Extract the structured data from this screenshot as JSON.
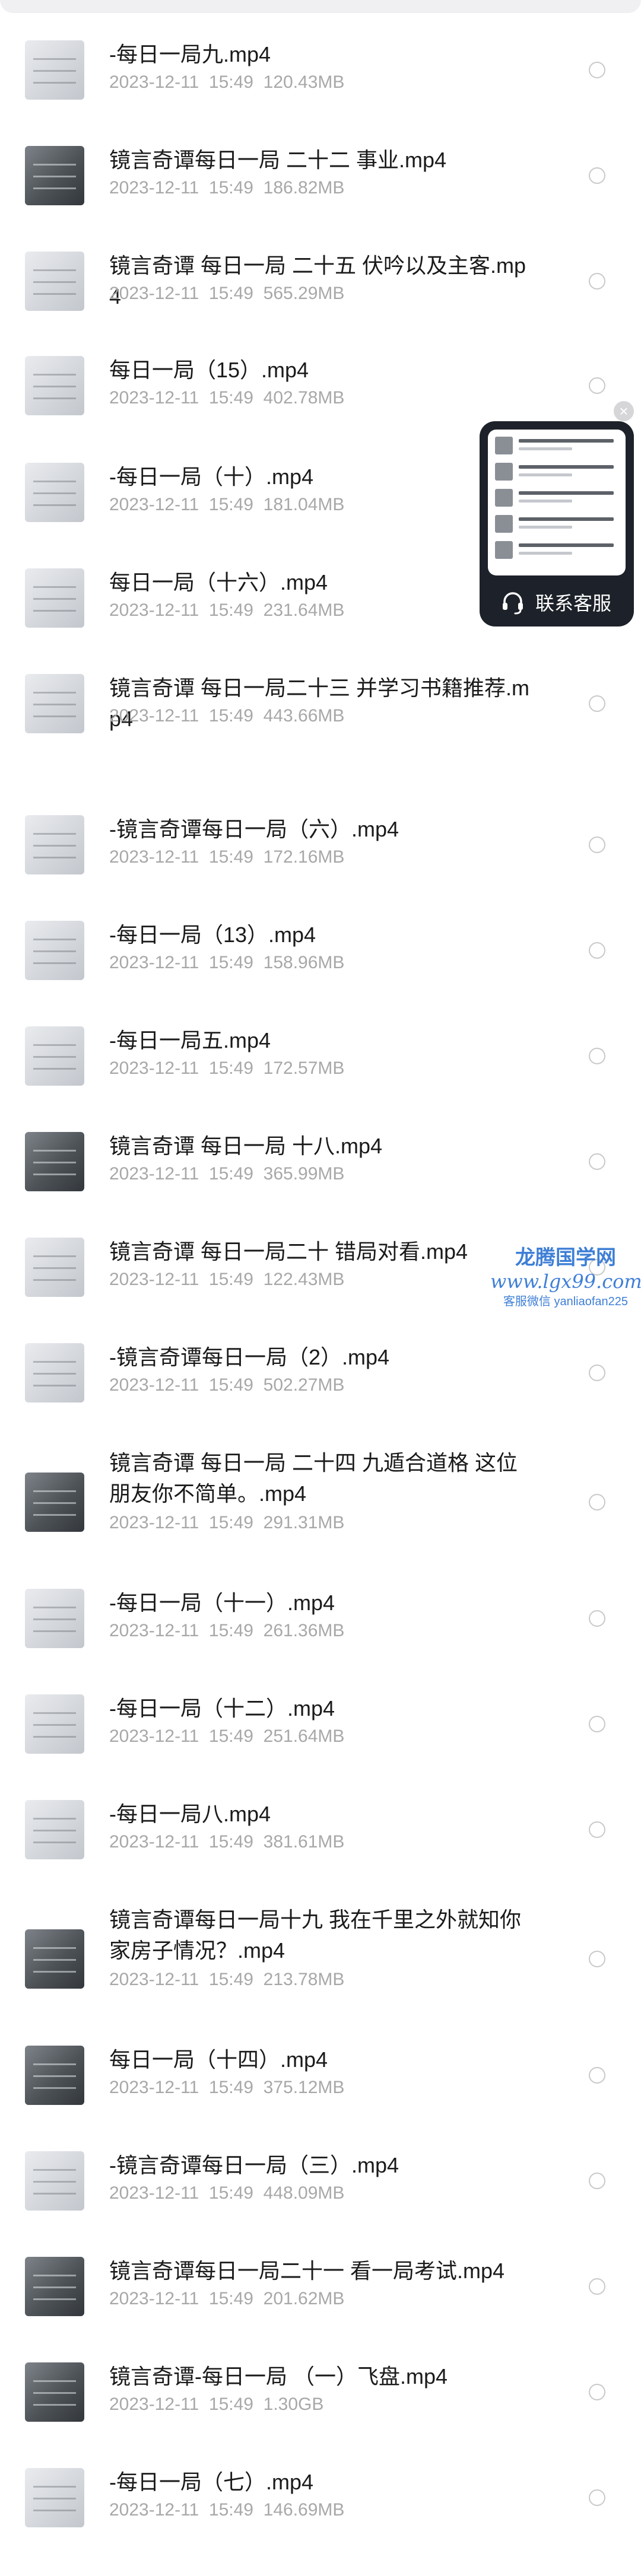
{
  "files": [
    {
      "name": "-每日一局九.mp4",
      "date": "2023-12-11",
      "time": "15:49",
      "size": "120.43MB",
      "thumb": "light"
    },
    {
      "name": "镜言奇谭每日一局 二十二 事业.mp4",
      "date": "2023-12-11",
      "time": "15:49",
      "size": "186.82MB",
      "thumb": "dark"
    },
    {
      "name": "镜言奇谭 每日一局 二十五 伏吟以及主客.mp4",
      "date": "2023-12-11",
      "time": "15:49",
      "size": "565.29MB",
      "thumb": "light"
    },
    {
      "name": "每日一局（15）.mp4",
      "date": "2023-12-11",
      "time": "15:49",
      "size": "402.78MB",
      "thumb": "light"
    },
    {
      "name": "-每日一局（十）.mp4",
      "date": "2023-12-11",
      "time": "15:49",
      "size": "181.04MB",
      "thumb": "light"
    },
    {
      "name": "每日一局（十六）.mp4",
      "date": "2023-12-11",
      "time": "15:49",
      "size": "231.64MB",
      "thumb": "light"
    },
    {
      "name": "镜言奇谭 每日一局二十三 并学习书籍推荐.mp4",
      "date": "2023-12-11",
      "time": "15:49",
      "size": "443.66MB",
      "thumb": "light"
    },
    {
      "name": "-镜言奇谭每日一局（六）.mp4",
      "date": "2023-12-11",
      "time": "15:49",
      "size": "172.16MB",
      "thumb": "light"
    },
    {
      "name": "-每日一局（13）.mp4",
      "date": "2023-12-11",
      "time": "15:49",
      "size": "158.96MB",
      "thumb": "light"
    },
    {
      "name": "-每日一局五.mp4",
      "date": "2023-12-11",
      "time": "15:49",
      "size": "172.57MB",
      "thumb": "light"
    },
    {
      "name": "镜言奇谭 每日一局 十八.mp4",
      "date": "2023-12-11",
      "time": "15:49",
      "size": "365.99MB",
      "thumb": "dark"
    },
    {
      "name": "镜言奇谭 每日一局二十 错局对看.mp4",
      "date": "2023-12-11",
      "time": "15:49",
      "size": "122.43MB",
      "thumb": "light"
    },
    {
      "name": "-镜言奇谭每日一局（2）.mp4",
      "date": "2023-12-11",
      "time": "15:49",
      "size": "502.27MB",
      "thumb": "light"
    },
    {
      "name": "镜言奇谭 每日一局 二十四 九遁合道格 这位朋友你不简单。.mp4",
      "date": "2023-12-11",
      "time": "15:49",
      "size": "291.31MB",
      "thumb": "dark"
    },
    {
      "name": "-每日一局（十一）.mp4",
      "date": "2023-12-11",
      "time": "15:49",
      "size": "261.36MB",
      "thumb": "light"
    },
    {
      "name": "-每日一局（十二）.mp4",
      "date": "2023-12-11",
      "time": "15:49",
      "size": "251.64MB",
      "thumb": "light"
    },
    {
      "name": "-每日一局八.mp4",
      "date": "2023-12-11",
      "time": "15:49",
      "size": "381.61MB",
      "thumb": "light"
    },
    {
      "name": "镜言奇谭每日一局十九  我在千里之外就知你家房子情况？.mp4",
      "date": "2023-12-11",
      "time": "15:49",
      "size": "213.78MB",
      "thumb": "dark"
    },
    {
      "name": "每日一局（十四）.mp4",
      "date": "2023-12-11",
      "time": "15:49",
      "size": "375.12MB",
      "thumb": "dark"
    },
    {
      "name": "-镜言奇谭每日一局（三）.mp4",
      "date": "2023-12-11",
      "time": "15:49",
      "size": "448.09MB",
      "thumb": "light"
    },
    {
      "name": "镜言奇谭每日一局二十一  看一局考试.mp4",
      "date": "2023-12-11",
      "time": "15:49",
      "size": "201.62MB",
      "thumb": "dark"
    },
    {
      "name": "镜言奇谭-每日一局 （一）飞盘.mp4",
      "date": "2023-12-11",
      "time": "15:49",
      "size": "1.30GB",
      "thumb": "dark"
    },
    {
      "name": "-每日一局（七）.mp4",
      "date": "2023-12-11",
      "time": "15:49",
      "size": "146.69MB",
      "thumb": "light"
    }
  ],
  "float_widget": {
    "label": "联系客服",
    "icon": "headset-icon",
    "close_icon": "close-icon"
  },
  "watermark": {
    "title": "龙腾国学网",
    "url": "www.lgx99.com",
    "contact": "客服微信 yanliaofan225"
  },
  "colors": {
    "text_primary": "#1a1a1a",
    "text_meta": "#a8a8a8",
    "widget_bg": "#1d2129",
    "watermark": "#3f7fd6"
  }
}
